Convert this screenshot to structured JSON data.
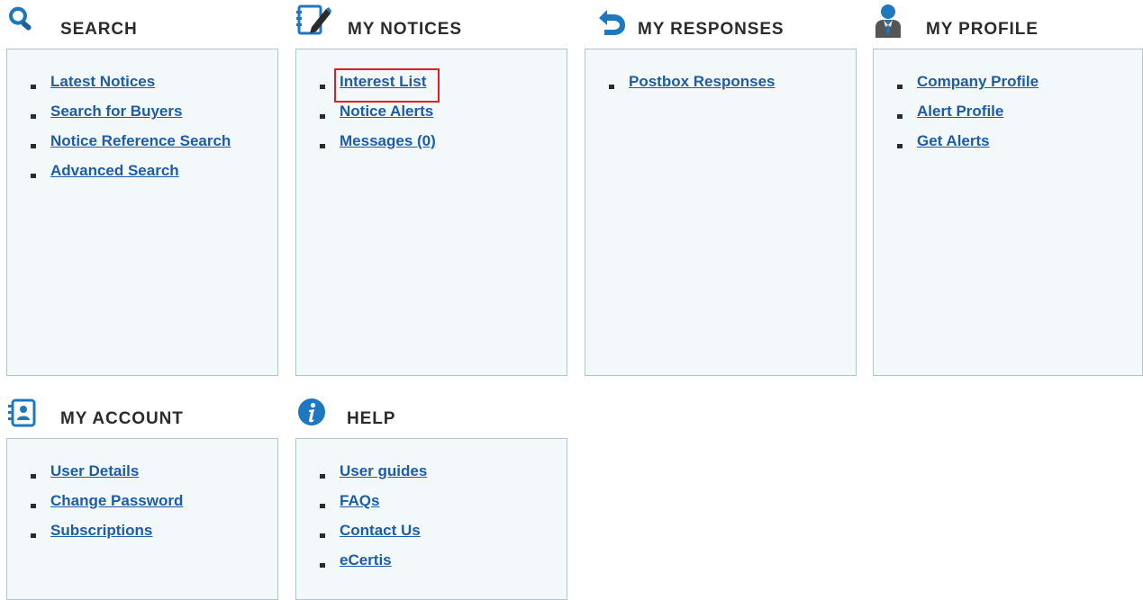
{
  "panels": {
    "search": {
      "title": "SEARCH",
      "icon": "magnifier-icon",
      "links": [
        "Latest Notices",
        "Search for Buyers",
        "Notice Reference Search",
        "Advanced Search"
      ]
    },
    "my_notices": {
      "title": "MY NOTICES",
      "icon": "notepad-pencil-icon",
      "links": [
        "Interest List",
        "Notice Alerts",
        "Messages (0)"
      ],
      "highlighted_link": "Interest List"
    },
    "my_responses": {
      "title": "MY RESPONSES",
      "icon": "return-arrow-icon",
      "links": [
        "Postbox Responses"
      ]
    },
    "my_profile": {
      "title": "MY PROFILE",
      "icon": "person-icon",
      "links": [
        "Company Profile",
        "Alert Profile",
        "Get Alerts"
      ]
    },
    "my_account": {
      "title": "MY ACCOUNT",
      "icon": "contact-book-icon",
      "links": [
        "User Details",
        "Change Password",
        "Subscriptions"
      ]
    },
    "help": {
      "title": "HELP",
      "icon": "info-icon",
      "links": [
        "User guides",
        "FAQs",
        "Contact Us",
        "eCertis"
      ]
    }
  },
  "colors": {
    "link": "#1e5ca4",
    "panel_background": "#f3f8fb",
    "panel_border": "#b4c4cd",
    "icon_blue": "#1d78bf",
    "highlight": "#e21e25"
  }
}
